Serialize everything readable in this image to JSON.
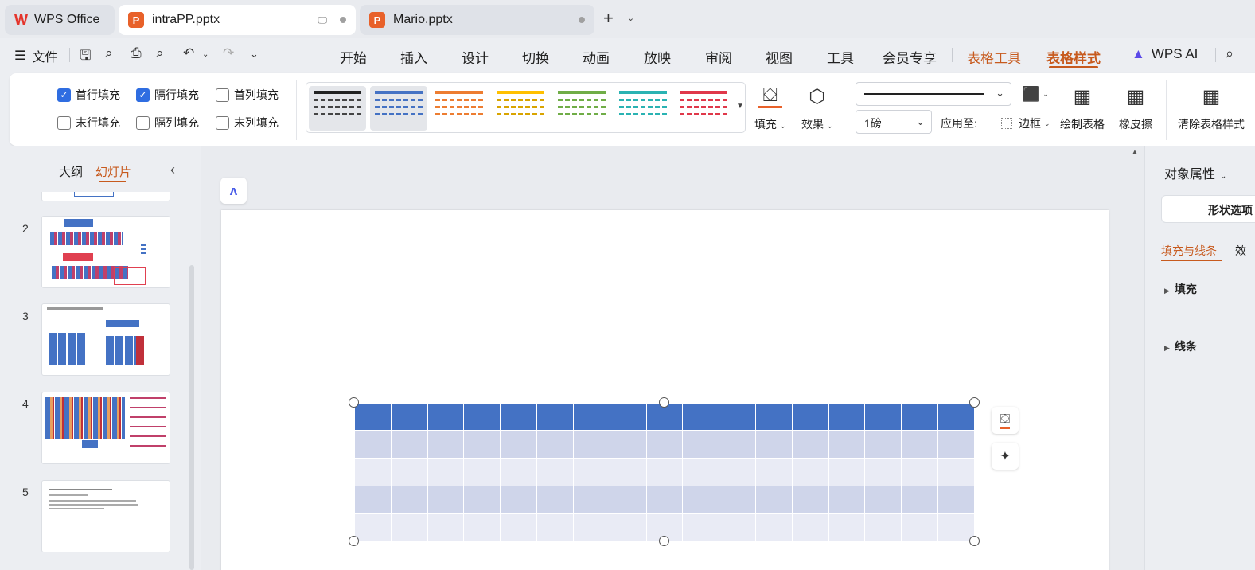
{
  "tabs": {
    "home": "WPS Office",
    "active_file": "intraPP.pptx",
    "other_file": "Mario.pptx",
    "badge": "P"
  },
  "menu": {
    "file": "文件",
    "items": [
      "开始",
      "插入",
      "设计",
      "切换",
      "动画",
      "放映",
      "审阅",
      "视图",
      "工具",
      "会员专享"
    ],
    "table_tools": "表格工具",
    "table_style": "表格样式",
    "wps_ai": "WPS AI"
  },
  "ribbon": {
    "checks": [
      {
        "label": "首行填充",
        "checked": true
      },
      {
        "label": "隔行填充",
        "checked": true
      },
      {
        "label": "首列填充",
        "checked": false
      },
      {
        "label": "末行填充",
        "checked": false
      },
      {
        "label": "隔列填充",
        "checked": false
      },
      {
        "label": "末列填充",
        "checked": false
      }
    ],
    "style_colors": [
      "#222222",
      "#4472c4",
      "#ed7d31",
      "#ffc000",
      "#70ad47",
      "#2ab3b3",
      "#e0384a"
    ],
    "fill": "填充",
    "effect": "效果",
    "line_weight": "1磅",
    "apply_to": "应用至:",
    "border": "边框",
    "draw_table": "绘制表格",
    "eraser": "橡皮擦",
    "clear_style": "清除表格样式"
  },
  "left_panel": {
    "tab_outline": "大纲",
    "tab_slides": "幻灯片",
    "slide_numbers": [
      "2",
      "3",
      "4",
      "5"
    ]
  },
  "right_panel": {
    "title": "对象属性",
    "shape_options": "形状选项",
    "tab_fill_line": "填充与线条",
    "tab_effect": "效",
    "section_fill": "填充",
    "section_line": "线条"
  },
  "table": {
    "columns": 17,
    "rows": 5,
    "header_color": "#4472c4",
    "band_color_1": "#cfd5ea",
    "band_color_2": "#e9ebf5"
  },
  "colors": {
    "accent": "#c75a1e",
    "checkbox": "#2f6de1"
  }
}
